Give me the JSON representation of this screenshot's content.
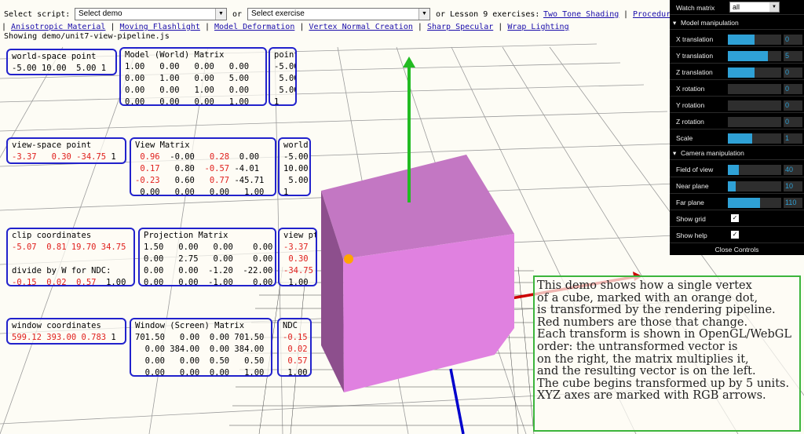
{
  "header": {
    "select_script_label": "Select script:",
    "select_script_value": "Select demo",
    "or_label": "or",
    "select_exercise_value": "Select exercise",
    "lesson_label": "or Lesson 9 exercises:",
    "lesson_links": [
      "Two Tone Shading",
      "Procedur"
    ],
    "links": [
      "Anisotropic Material",
      "Moving Flashlight",
      "Model Deformation",
      "Vertex Normal Creation",
      "Sharp Specular",
      "Wrap Lighting"
    ],
    "showing": "Showing demo/unit7-view-pipeline.js"
  },
  "panels": {
    "world_point": {
      "title": "world-space point",
      "rows": [
        [
          {
            "t": "-5.00 10.00  5.00 1",
            "red": false
          }
        ]
      ]
    },
    "model_matrix": {
      "title": "Model (World) Matrix",
      "rows": [
        [
          {
            "t": "1.00   0.00   0.00   0.00",
            "red": false
          }
        ],
        [
          {
            "t": "0.00   1.00   0.00   5.00",
            "red": false
          }
        ],
        [
          {
            "t": "0.00   0.00   1.00   0.00",
            "red": false
          }
        ],
        [
          {
            "t": "0.00   0.00   0.00   1.00",
            "red": false
          }
        ]
      ]
    },
    "point": {
      "title": "point",
      "rows": [
        [
          {
            "t": "-5.00",
            "red": false
          }
        ],
        [
          {
            "t": " 5.00",
            "red": false
          }
        ],
        [
          {
            "t": " 5.00",
            "red": false
          }
        ],
        [
          {
            "t": "1",
            "red": false
          }
        ]
      ]
    },
    "view_point": {
      "title": "view-space point",
      "rows": [
        [
          {
            "t": "-3.37   0.30 -34.75",
            "red": true
          },
          {
            "t": " 1",
            "red": false
          }
        ]
      ]
    },
    "view_matrix": {
      "title": "View Matrix",
      "rows": [
        [
          {
            "t": " 0.96",
            "red": true
          },
          {
            "t": "  -0.00   ",
            "red": false
          },
          {
            "t": "0.28",
            "red": true
          },
          {
            "t": "  0.00",
            "red": false
          }
        ],
        [
          {
            "t": " 0.17",
            "red": true
          },
          {
            "t": "   0.80  ",
            "red": false
          },
          {
            "t": "-0.57",
            "red": true
          },
          {
            "t": " -4.01",
            "red": false
          }
        ],
        [
          {
            "t": "-0.23",
            "red": true
          },
          {
            "t": "   0.60   ",
            "red": false
          },
          {
            "t": "0.77",
            "red": true
          },
          {
            "t": " -45.71",
            "red": false
          }
        ],
        [
          {
            "t": " 0.00   0.00   0.00   1.00",
            "red": false
          }
        ]
      ]
    },
    "world": {
      "title": "world",
      "rows": [
        [
          {
            "t": "-5.00",
            "red": false
          }
        ],
        [
          {
            "t": "10.00",
            "red": false
          }
        ],
        [
          {
            "t": " 5.00",
            "red": false
          }
        ],
        [
          {
            "t": "1",
            "red": false
          }
        ]
      ]
    },
    "clip": {
      "title": "clip coordinates",
      "rows": [
        [
          {
            "t": "-5.07  0.81 19.70 34.75",
            "red": true
          }
        ],
        [
          {
            "t": "",
            "red": false
          }
        ],
        [
          {
            "t": "divide by W for NDC:",
            "red": false
          }
        ],
        [
          {
            "t": "-0.15  0.02  0.57  ",
            "red": true
          },
          {
            "t": "1.00",
            "red": false
          }
        ]
      ]
    },
    "projection": {
      "title": "Projection Matrix",
      "rows": [
        [
          {
            "t": "1.50   0.00   0.00    0.00",
            "red": false
          }
        ],
        [
          {
            "t": "0.00   2.75   0.00    0.00",
            "red": false
          }
        ],
        [
          {
            "t": "0.00   0.00  -1.20  -22.00",
            "red": false
          }
        ],
        [
          {
            "t": "0.00   0.00  -1.00    0.00",
            "red": false
          }
        ]
      ]
    },
    "view_pt": {
      "title": "view pt",
      "rows": [
        [
          {
            "t": "-3.37",
            "red": true
          }
        ],
        [
          {
            "t": " 0.30",
            "red": true
          }
        ],
        [
          {
            "t": "-34.75",
            "red": true
          }
        ],
        [
          {
            "t": " 1.00",
            "red": false
          }
        ]
      ]
    },
    "window": {
      "title": "window coordinates",
      "rows": [
        [
          {
            "t": "599.12 393.00 0.783",
            "red": true
          },
          {
            "t": " 1",
            "red": false
          }
        ]
      ]
    },
    "window_matrix": {
      "title": "Window (Screen) Matrix",
      "rows": [
        [
          {
            "t": "701.50   0.00  0.00 701.50",
            "red": false
          }
        ],
        [
          {
            "t": "  0.00 384.00  0.00 384.00",
            "red": false
          }
        ],
        [
          {
            "t": "  0.00   0.00  0.50   0.50",
            "red": false
          }
        ],
        [
          {
            "t": "  0.00   0.00  0.00   1.00",
            "red": false
          }
        ]
      ]
    },
    "ndc": {
      "title": "NDC",
      "rows": [
        [
          {
            "t": "-0.15",
            "red": true
          }
        ],
        [
          {
            "t": " 0.02",
            "red": true
          }
        ],
        [
          {
            "t": " 0.57",
            "red": true
          }
        ],
        [
          {
            "t": " 1.00",
            "red": false
          }
        ]
      ]
    }
  },
  "help": {
    "lines": [
      "This demo shows how a single vertex",
      "of a cube, marked with an orange dot,",
      "is transformed by the rendering pipeline.",
      "Red numbers are those that change.",
      "Each transform is shown in OpenGL/WebGL",
      "order: the untransformed vector is",
      "on the right, the matrix multiplies it,",
      "and the resulting vector is on the left.",
      "The cube begins transformed up by 5 units.",
      "XYZ axes are marked with RGB arrows."
    ]
  },
  "controls": {
    "watch_label": "Watch matrix",
    "watch_value": "all",
    "model_header": "Model manipulation",
    "model": [
      {
        "label": "X translation",
        "value": "0",
        "fill": 0.5
      },
      {
        "label": "Y translation",
        "value": "5",
        "fill": 0.75
      },
      {
        "label": "Z translation",
        "value": "0",
        "fill": 0.5
      },
      {
        "label": "X rotation",
        "value": "0",
        "fill": 0.0
      },
      {
        "label": "Y rotation",
        "value": "0",
        "fill": 0.0
      },
      {
        "label": "Z rotation",
        "value": "0",
        "fill": 0.0
      },
      {
        "label": "Scale",
        "value": "1",
        "fill": 0.45
      }
    ],
    "camera_header": "Camera manipulation",
    "camera": [
      {
        "label": "Field of view",
        "value": "40",
        "fill": 0.2
      },
      {
        "label": "Near plane",
        "value": "10",
        "fill": 0.15
      },
      {
        "label": "Far plane",
        "value": "110",
        "fill": 0.6
      }
    ],
    "show_grid_label": "Show grid",
    "show_help_label": "Show help",
    "close_label": "Close Controls"
  },
  "colors": {
    "panel_border": "#2222cc",
    "help_border": "#3cb53c",
    "changed_number": "#e0201d",
    "cube": "#e07fe0",
    "slider_fill": "#2fa1d6",
    "vertex_dot": "#ffa500"
  }
}
